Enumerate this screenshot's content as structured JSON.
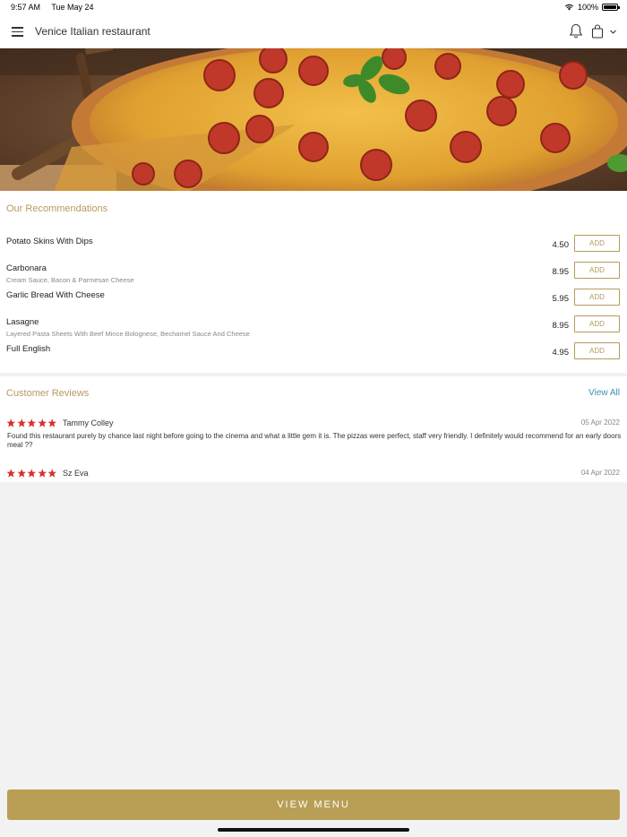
{
  "status_bar": {
    "time": "9:57 AM",
    "date": "Tue May 24",
    "battery": "100%"
  },
  "header": {
    "title": "Venice Italian restaurant"
  },
  "recommendations": {
    "title": "Our Recommendations",
    "add_label": "ADD",
    "items": [
      {
        "name": "Potato Skins With Dips",
        "desc": "",
        "price": "4.50"
      },
      {
        "name": "Carbonara",
        "desc": "Cream Sauce, Bacon & Parmesan Cheese",
        "price": "8.95"
      },
      {
        "name": "Garlic Bread With Cheese",
        "desc": "",
        "price": "5.95"
      },
      {
        "name": "Lasagne",
        "desc": "Layered Pasta Sheets With Beef Mince Bolognese, Bechamel Sauce And Cheese",
        "price": "8.95"
      },
      {
        "name": "Full English",
        "desc": "",
        "price": "4.95"
      }
    ]
  },
  "reviews": {
    "title": "Customer Reviews",
    "view_all": "View All",
    "items": [
      {
        "name": "Tammy Colley",
        "date": "05 Apr 2022",
        "rating": 5,
        "text": "Found this restaurant purely by chance last night before going to the cinema and what a little gem it is. The pizzas were perfect, staff very friendly. I definitely would recommend for an early doors meal ??"
      },
      {
        "name": "Sz Eva",
        "date": "04 Apr 2022",
        "rating": 5,
        "text": ""
      }
    ]
  },
  "footer": {
    "view_menu": "VIEW MENU"
  },
  "colors": {
    "accent": "#b89f55",
    "star": "#d9302e",
    "link": "#3a8fb7"
  }
}
